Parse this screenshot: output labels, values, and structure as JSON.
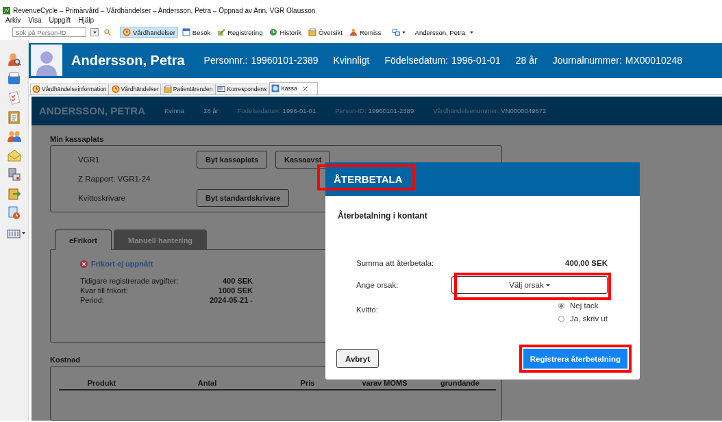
{
  "window": {
    "title": "RevenueCycle – Primärvård – Vårdhändelser – Andersson, Petra – Öppnad av Ann, VGR Olausson"
  },
  "menu": [
    "Arkiv",
    "Visa",
    "Uppgift",
    "Hjälp"
  ],
  "toolbar": {
    "search": {
      "placeholder": "Sök på Person-ID"
    },
    "buttons": [
      {
        "label": "Vårdhändelser",
        "selected": true
      },
      {
        "label": "Besök",
        "selected": false
      },
      {
        "label": "Registrering",
        "selected": false
      },
      {
        "label": "Historik",
        "selected": false
      },
      {
        "label": "Översikt",
        "selected": false
      },
      {
        "label": "Remiss",
        "selected": false
      }
    ],
    "patient_menu": "Andersson, Petra"
  },
  "patient_banner": {
    "name": "Andersson, Petra",
    "fields": [
      {
        "label": "Personnr.:",
        "value": "19960101-2389"
      },
      {
        "value": "Kvinnligt"
      },
      {
        "label": "Födelsedatum:",
        "value": "1996-01-01"
      },
      {
        "value": "28 år"
      },
      {
        "label": "Journalnummer:",
        "value": "MX00010248"
      }
    ]
  },
  "tabs": [
    {
      "label": "Vårdhändelseinformation",
      "selected": false,
      "closable": false
    },
    {
      "label": "Vårdhändelser",
      "selected": false,
      "closable": false
    },
    {
      "label": "Patientärenden",
      "selected": false,
      "closable": false
    },
    {
      "label": "Korrespondens",
      "selected": false,
      "closable": false
    },
    {
      "label": "Kassa",
      "selected": true,
      "closable": true
    }
  ],
  "case_header": {
    "name": "ANDERSSON, PETRA",
    "fields": [
      {
        "value": "Kvinna"
      },
      {
        "value": "28 år"
      },
      {
        "label": "Födelsedatum:",
        "value": "1996-01-01"
      },
      {
        "label": "Person-ID:",
        "value": "19960101-2389"
      },
      {
        "label": "Vårdhändelsenummer:",
        "value": "VN0000049672"
      }
    ]
  },
  "checkout": {
    "title": "Min kassaplats",
    "rows": [
      {
        "label": "VGR1",
        "buttons": [
          "Byt kassaplats",
          "Kassaavst"
        ]
      },
      {
        "label": "Z Rapport: VGR1-24",
        "buttons": []
      },
      {
        "label": "Kvittoskrivare",
        "buttons": [
          "Byt standardskrivare"
        ]
      }
    ]
  },
  "frikort_tabs": [
    {
      "label": "eFrikort",
      "selected": true
    },
    {
      "label": "Manuell hantering",
      "selected": false
    }
  ],
  "frikort": {
    "status": "Frikort ej uppnått",
    "rows": [
      {
        "label": "Tidigare registrerade avgifter:",
        "value": "400 SEK"
      },
      {
        "label": "Kvar till frikort:",
        "value": "1000 SEK"
      },
      {
        "label": "Period:",
        "value": "2024-05-21 -"
      }
    ]
  },
  "cost": {
    "title": "Kostnad",
    "columns": [
      "Produkt",
      "Antal",
      "Pris",
      "varav MOMS",
      "grundande"
    ]
  },
  "dialog": {
    "title": "ÅTERBETALA",
    "title_highlighted": true,
    "subtitle": "Återbetalning i kontant",
    "amount": {
      "label": "Summa att återbetala:",
      "value": "400,00 SEK"
    },
    "reason": {
      "label": "Ange orsak:",
      "value": "Välj orsak",
      "highlighted": true
    },
    "receipt": {
      "label": "Kvitto:",
      "options": [
        {
          "label": "Nej tack",
          "selected": true
        },
        {
          "label": "Ja, skriv ut",
          "selected": false
        }
      ]
    },
    "cancel": "Avbryt",
    "submit": {
      "label": "Registrera återbetalning",
      "highlighted": true
    }
  }
}
